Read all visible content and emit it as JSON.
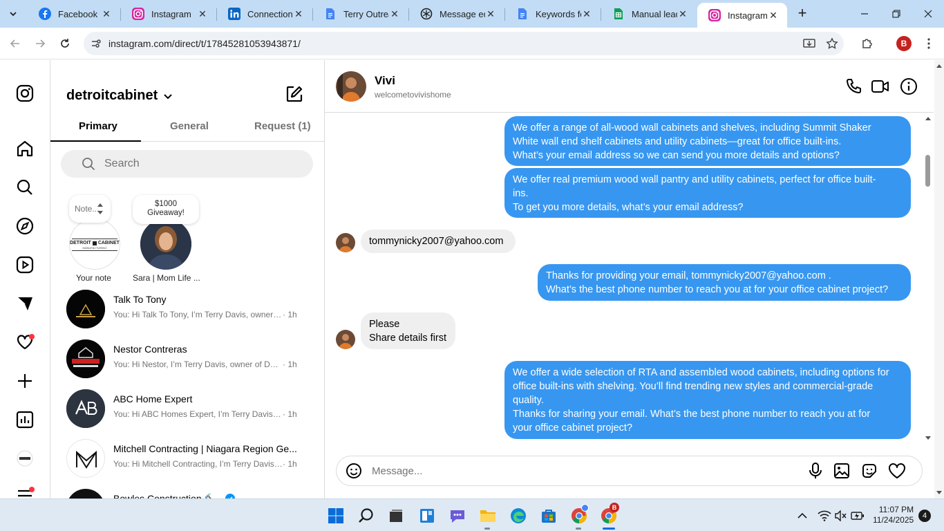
{
  "browser": {
    "tabs": [
      {
        "title": "Facebook",
        "icon": "facebook-icon"
      },
      {
        "title": "Instagram",
        "icon": "instagram-icon"
      },
      {
        "title": "Connections",
        "icon": "linkedin-icon"
      },
      {
        "title": "Terry Outrea",
        "icon": "docs-icon"
      },
      {
        "title": "Message edi",
        "icon": "chatgpt-icon"
      },
      {
        "title": "Keywords fo",
        "icon": "docs-icon"
      },
      {
        "title": "Manual lead",
        "icon": "sheets-icon"
      },
      {
        "title": "Instagram • ",
        "icon": "instagram-icon"
      }
    ],
    "url": "instagram.com/direct/t/17845281053943871/",
    "profile_initial": "B"
  },
  "inbox": {
    "account": "detroitcabinet",
    "tabs": [
      "Primary",
      "General",
      "Request (1)"
    ],
    "search_placeholder": "Search",
    "notes": [
      {
        "bubble": "Note...",
        "label": "Your note",
        "logo_top": "DETROIT",
        "logo_mid": "CABINET",
        "logo_bottom": "MANUFACTURING"
      },
      {
        "bubble": "$1000\nGiveaway!",
        "label": "Sara | Mom Life ..."
      }
    ],
    "threads": [
      {
        "name": "Talk To Tony",
        "preview": "You: Hi Talk To Tony, I’m Terry Davis, owner o...",
        "time": "· 1h"
      },
      {
        "name": "Nestor Contreras",
        "preview": "You: Hi Nestor, I’m Terry Davis, owner of Det...",
        "time": "· 1h"
      },
      {
        "name": "ABC Home Expert",
        "preview": "You: Hi ABC Homes Expert, I’m Terry Davis, o...",
        "time": "· 1h"
      },
      {
        "name": "Mitchell Contracting | Niagara Region Ge...",
        "preview": "You: Hi Mitchell Contracting, I’m Terry Davis, ...",
        "time": "· 1h"
      },
      {
        "name": "Bowles Construction 🔨",
        "preview": "",
        "time": ""
      }
    ]
  },
  "chat": {
    "name": "Vivi",
    "username": "welcometovivishome",
    "messages": [
      {
        "dir": "out",
        "text": "We offer a range of all-wood wall cabinets and shelves, including Summit Shaker\nWhite wall end shelf cabinets and utility cabinets—great for office built-ins.\nWhat’s your email address so we can send you more details and options?"
      },
      {
        "dir": "out",
        "text": "We offer real premium wood wall pantry and utility cabinets, perfect for office built-\nins.\nTo get you more details, what’s your email address?"
      },
      {
        "dir": "in",
        "text": "tommynicky2007@yahoo.com"
      },
      {
        "dir": "out",
        "text": "Thanks for providing your email, tommynicky2007@yahoo.com .\nWhat’s the best phone number to reach you at for your office cabinet project?"
      },
      {
        "dir": "in",
        "text": "Please\nShare details first"
      },
      {
        "dir": "out",
        "text": "We offer a wide selection of RTA and assembled wood cabinets, including options for\noffice built-ins with shelving. You’ll find trending new styles and commercial-grade\nquality.\nThanks for sharing your email. What’s the best phone number to reach you at for\nyour office cabinet project?"
      }
    ],
    "composer_placeholder": "Message..."
  },
  "taskbar": {
    "time": "11:07 PM",
    "date": "11/24/2025",
    "notifications": "4",
    "chrome_badge": "B"
  },
  "colors": {
    "outgoing_bubble": "#3797f0",
    "incoming_bubble": "#efefef",
    "tabstrip": "#c2dcf5",
    "taskbar": "#dfe9f4",
    "notification_dot": "#ff3040"
  }
}
